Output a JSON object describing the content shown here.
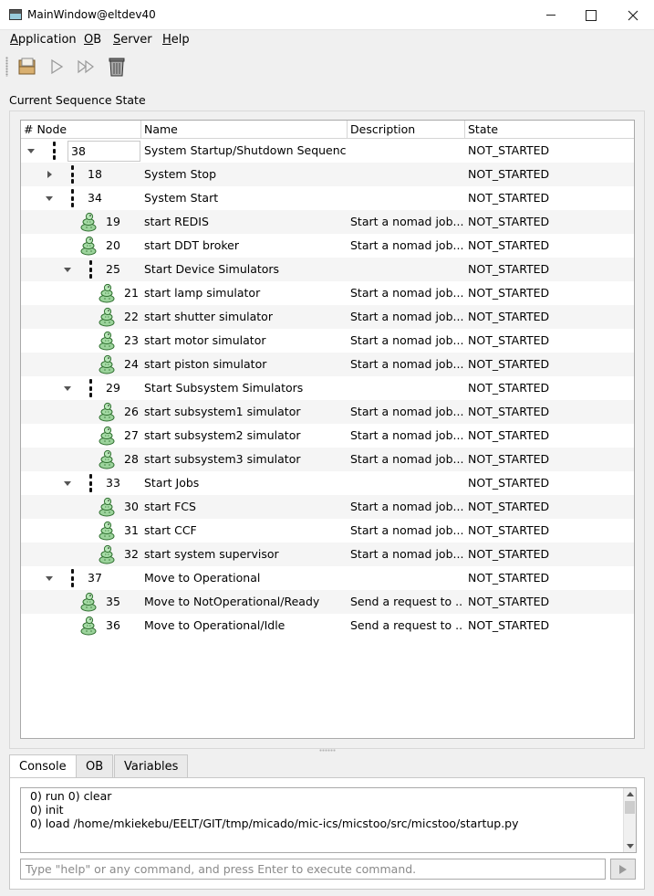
{
  "window": {
    "title": "MainWindow@eltdev40"
  },
  "menu": [
    "Application",
    "OB",
    "Server",
    "Help"
  ],
  "toolbar": {
    "icons": [
      "open-ob-icon",
      "run-icon",
      "run-all-icon",
      "trash-icon"
    ]
  },
  "sequence": {
    "label": "Current Sequence State",
    "columns": [
      "# Node",
      "Name",
      "Description",
      "State"
    ],
    "rows": [
      {
        "id": "38",
        "depth": 0,
        "kind": "seq",
        "expander": "open",
        "name": "System Startup/Shutdown Sequence",
        "desc": "",
        "state": "NOT_STARTED",
        "selected": true
      },
      {
        "id": "18",
        "depth": 1,
        "kind": "seq",
        "expander": "closed",
        "name": "System Stop",
        "desc": "",
        "state": "NOT_STARTED"
      },
      {
        "id": "34",
        "depth": 1,
        "kind": "seq",
        "expander": "open",
        "name": "System Start",
        "desc": "",
        "state": "NOT_STARTED"
      },
      {
        "id": "19",
        "depth": 2,
        "kind": "action",
        "name": "start REDIS",
        "desc": "Start a nomad job...",
        "state": "NOT_STARTED"
      },
      {
        "id": "20",
        "depth": 2,
        "kind": "action",
        "name": "start DDT broker",
        "desc": "Start a nomad job...",
        "state": "NOT_STARTED"
      },
      {
        "id": "25",
        "depth": 2,
        "kind": "seq",
        "expander": "open",
        "name": "Start Device Simulators",
        "desc": "",
        "state": "NOT_STARTED"
      },
      {
        "id": "21",
        "depth": 3,
        "kind": "action",
        "name": "start lamp simulator",
        "desc": "Start a nomad job...",
        "state": "NOT_STARTED"
      },
      {
        "id": "22",
        "depth": 3,
        "kind": "action",
        "name": "start shutter simulator",
        "desc": "Start a nomad job...",
        "state": "NOT_STARTED"
      },
      {
        "id": "23",
        "depth": 3,
        "kind": "action",
        "name": "start motor simulator",
        "desc": "Start a nomad job...",
        "state": "NOT_STARTED"
      },
      {
        "id": "24",
        "depth": 3,
        "kind": "action",
        "name": "start piston simulator",
        "desc": "Start a nomad job...",
        "state": "NOT_STARTED"
      },
      {
        "id": "29",
        "depth": 2,
        "kind": "seq",
        "expander": "open",
        "name": "Start Subsystem Simulators",
        "desc": "",
        "state": "NOT_STARTED"
      },
      {
        "id": "26",
        "depth": 3,
        "kind": "action",
        "name": "start subsystem1 simulator",
        "desc": "Start a nomad job...",
        "state": "NOT_STARTED"
      },
      {
        "id": "27",
        "depth": 3,
        "kind": "action",
        "name": "start subsystem2 simulator",
        "desc": "Start a nomad job...",
        "state": "NOT_STARTED"
      },
      {
        "id": "28",
        "depth": 3,
        "kind": "action",
        "name": "start subsystem3 simulator",
        "desc": "Start a nomad job...",
        "state": "NOT_STARTED"
      },
      {
        "id": "33",
        "depth": 2,
        "kind": "seq",
        "expander": "open",
        "name": "Start Jobs",
        "desc": "",
        "state": "NOT_STARTED"
      },
      {
        "id": "30",
        "depth": 3,
        "kind": "action",
        "name": "start FCS",
        "desc": "Start a nomad job...",
        "state": "NOT_STARTED"
      },
      {
        "id": "31",
        "depth": 3,
        "kind": "action",
        "name": "start CCF",
        "desc": "Start a nomad job...",
        "state": "NOT_STARTED"
      },
      {
        "id": "32",
        "depth": 3,
        "kind": "action",
        "name": "start system supervisor",
        "desc": "Start a nomad job...",
        "state": "NOT_STARTED"
      },
      {
        "id": "37",
        "depth": 1,
        "kind": "seq",
        "expander": "open",
        "name": "Move to Operational",
        "desc": "",
        "state": "NOT_STARTED"
      },
      {
        "id": "35",
        "depth": 2,
        "kind": "action",
        "name": "Move to NotOperational/Ready",
        "desc": "Send a request to ...",
        "state": "NOT_STARTED"
      },
      {
        "id": "36",
        "depth": 2,
        "kind": "action",
        "name": "Move to Operational/Idle",
        "desc": "Send a request to ...",
        "state": "NOT_STARTED"
      }
    ]
  },
  "tabs": [
    "Console",
    "OB",
    "Variables"
  ],
  "console": {
    "lines": [
      "0) run  0) clear",
      "0) init",
      "0) load /home/mkiekebu/EELT/GIT/tmp/micado/mic-ics/micstoo/src/micstoo/startup.py"
    ],
    "input_value": "",
    "input_placeholder": "Type \"help\" or any command, and press Enter to execute command."
  }
}
